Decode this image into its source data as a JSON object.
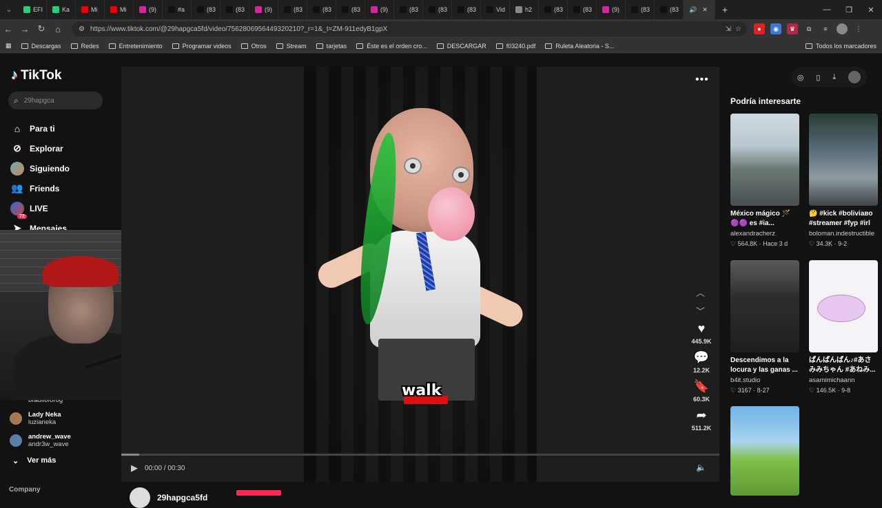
{
  "browser": {
    "tabs": [
      {
        "label": "EFI",
        "color": "#21d07a"
      },
      {
        "label": "Ka",
        "color": "#21d07a"
      },
      {
        "label": "Mi",
        "color": "#e00"
      },
      {
        "label": "Mi",
        "color": "#e00"
      },
      {
        "label": "(9)",
        "color": "#d6249f"
      },
      {
        "label": "#a",
        "color": "#111"
      },
      {
        "label": "(83",
        "color": "#111"
      },
      {
        "label": "(83",
        "color": "#111"
      },
      {
        "label": "(9)",
        "color": "#d6249f"
      },
      {
        "label": "(83",
        "color": "#111"
      },
      {
        "label": "(83",
        "color": "#111"
      },
      {
        "label": "(83",
        "color": "#111"
      },
      {
        "label": "(9)",
        "color": "#d6249f"
      },
      {
        "label": "(83",
        "color": "#111"
      },
      {
        "label": "(83",
        "color": "#111"
      },
      {
        "label": "(83",
        "color": "#111"
      },
      {
        "label": "Vid",
        "color": "#111"
      },
      {
        "label": "h2",
        "color": "#888"
      },
      {
        "label": "(83",
        "color": "#111"
      },
      {
        "label": "(83",
        "color": "#111"
      },
      {
        "label": "(9)",
        "color": "#d6249f"
      },
      {
        "label": "(83",
        "color": "#111"
      },
      {
        "label": "(83",
        "color": "#111"
      }
    ],
    "url": "https://www.tiktok.com/@29hapgca5fd/video/7562806956449320210?_r=1&_t=ZM-911edyB1gpX",
    "bookmarks": [
      "Descargas",
      "Redes",
      "Entretenimiento",
      "Programar videos",
      "Otros",
      "Stream",
      "tarjetas",
      "Éste es el orden cro...",
      "DESCARGAR",
      "f03240.pdf",
      "Ruleta Aleatoria - S..."
    ],
    "bookmarks_right": "Todos los marcadores"
  },
  "sidebar": {
    "logo": "TikTok",
    "search_value": "29hapgca",
    "nav": [
      {
        "label": "Para ti",
        "icon": "home-icon"
      },
      {
        "label": "Explorar",
        "icon": "compass-icon"
      },
      {
        "label": "Siguiendo",
        "icon": "following-avatar"
      },
      {
        "label": "Friends",
        "icon": "friends-icon"
      },
      {
        "label": "LIVE",
        "icon": "live-avatar"
      },
      {
        "label": "Mensajes",
        "icon": "send-icon",
        "badge": "72"
      }
    ],
    "following_partial": "bradlioforog",
    "following": [
      {
        "name": "Lady Neka",
        "user": "luzianeka"
      },
      {
        "name": "andrew_wave",
        "user": "andr3w_wave"
      }
    ],
    "ver_mas": "Ver más",
    "company": "Company"
  },
  "video": {
    "caption": "walk",
    "likes": "445.9K",
    "comments": "12.2K",
    "saves": "60.3K",
    "shares": "511.2K",
    "time": "00:00 / 00:30",
    "progress_fraction": 0.03,
    "author": "29hapgca5fd"
  },
  "suggestions": {
    "title": "Podría interesarte",
    "cards": [
      {
        "title": "México mágico 🪄 🟣🟣 es #ia...",
        "user": "alexandracherz",
        "likes": "564.8K",
        "date": "Hace 3 d"
      },
      {
        "title": "🤔 #kick #boliviaвo #streamer #fyp #irl",
        "user": "boloman.indestructible",
        "likes": "34.3K",
        "date": "9-2"
      },
      {
        "title": "Descendimos a la locura y las ganas ...",
        "user": "b4it.studio",
        "likes": "3167",
        "date": "8-27"
      },
      {
        "title": "ぱんぱんぱん♪#あさみみちゃん #あねみ...",
        "user": "asamimichaann",
        "likes": "146.5K",
        "date": "9-8"
      }
    ]
  },
  "colors": {
    "accent": "#fe2c55",
    "background": "#121212"
  }
}
